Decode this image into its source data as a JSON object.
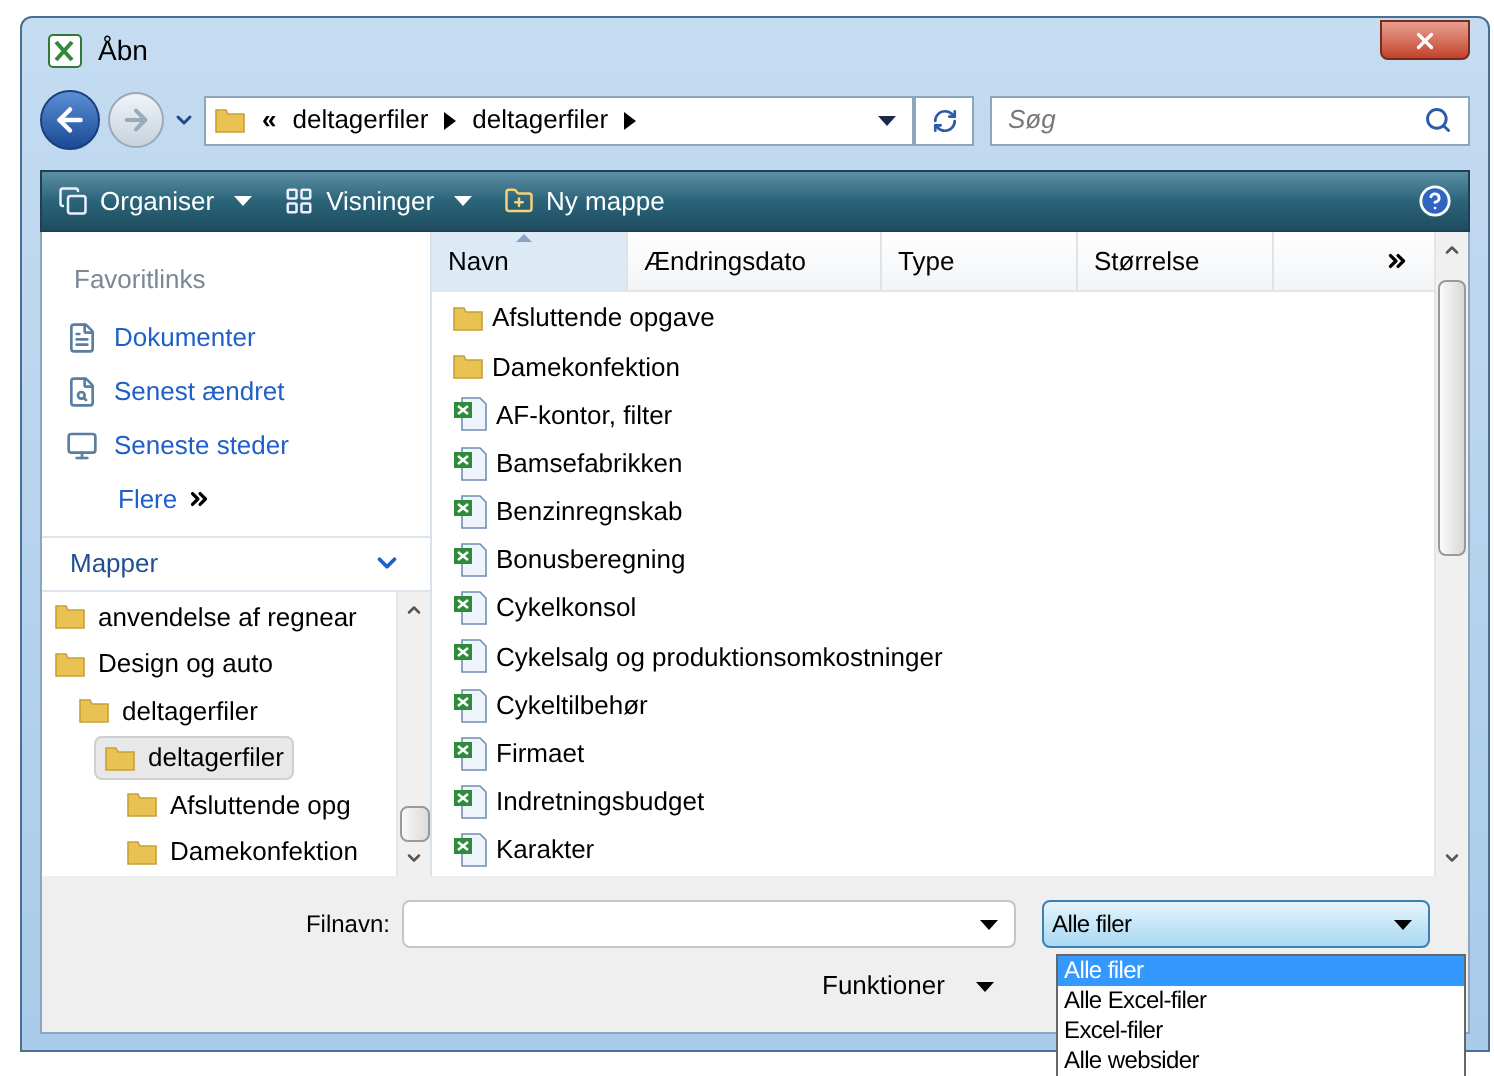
{
  "window": {
    "title": "Åbn"
  },
  "address": {
    "overflow": "«",
    "crumbs": [
      "deltagerfiler",
      "deltagerfiler"
    ]
  },
  "search": {
    "placeholder": "Søg"
  },
  "toolbar": {
    "items": [
      {
        "label": "Organiser",
        "kind": "menu"
      },
      {
        "label": "Visninger",
        "kind": "menu"
      },
      {
        "label": "Ny mappe",
        "kind": "button"
      }
    ]
  },
  "sidebar": {
    "favorites_title": "Favoritlinks",
    "links": [
      {
        "label": "Dokumenter"
      },
      {
        "label": "Senest ændret"
      },
      {
        "label": "Seneste steder"
      }
    ],
    "more": "Flere",
    "folders_title": "Mapper",
    "tree": [
      {
        "label": "anvendelse af regnear",
        "selected": false
      },
      {
        "label": "Design og auto",
        "selected": false,
        "children": [
          {
            "label": "deltagerfiler",
            "selected": false,
            "children": [
              {
                "label": "deltagerfiler",
                "selected": true,
                "children": [
                  {
                    "label": "Afsluttende opg",
                    "selected": false
                  },
                  {
                    "label": "Damekonfektion",
                    "selected": false
                  }
                ]
              }
            ]
          }
        ]
      }
    ]
  },
  "table": {
    "columns": [
      {
        "label": "Navn",
        "sorted": true
      },
      {
        "label": "Ændringsdato",
        "sorted": false
      },
      {
        "label": "Type",
        "sorted": false
      },
      {
        "label": "Størrelse",
        "sorted": false
      }
    ],
    "rows": [
      {
        "name": "Afsluttende opgave",
        "kind": "folder"
      },
      {
        "name": "Damekonfektion",
        "kind": "folder"
      },
      {
        "name": "AF-kontor, filter",
        "kind": "excel"
      },
      {
        "name": "Bamsefabrikken",
        "kind": "excel"
      },
      {
        "name": "Benzinregnskab",
        "kind": "excel"
      },
      {
        "name": "Bonusberegning",
        "kind": "excel"
      },
      {
        "name": "Cykelkonsol",
        "kind": "excel"
      },
      {
        "name": "Cykelsalg og produktionsomkostninger",
        "kind": "excel"
      },
      {
        "name": "Cykeltilbehør",
        "kind": "excel"
      },
      {
        "name": "Firmaet",
        "kind": "excel"
      },
      {
        "name": "Indretningsbudget",
        "kind": "excel"
      },
      {
        "name": "Karakter",
        "kind": "excel"
      }
    ]
  },
  "footer": {
    "filename_label": "Filnavn:",
    "filter": {
      "value": "Alle filer",
      "expanded": true,
      "options": [
        {
          "label": "Alle filer",
          "selected": true
        },
        {
          "label": "Alle Excel-filer",
          "selected": false
        },
        {
          "label": "Excel-filer",
          "selected": false
        },
        {
          "label": "Alle websider",
          "selected": false
        }
      ]
    },
    "tools": "Funktioner"
  }
}
